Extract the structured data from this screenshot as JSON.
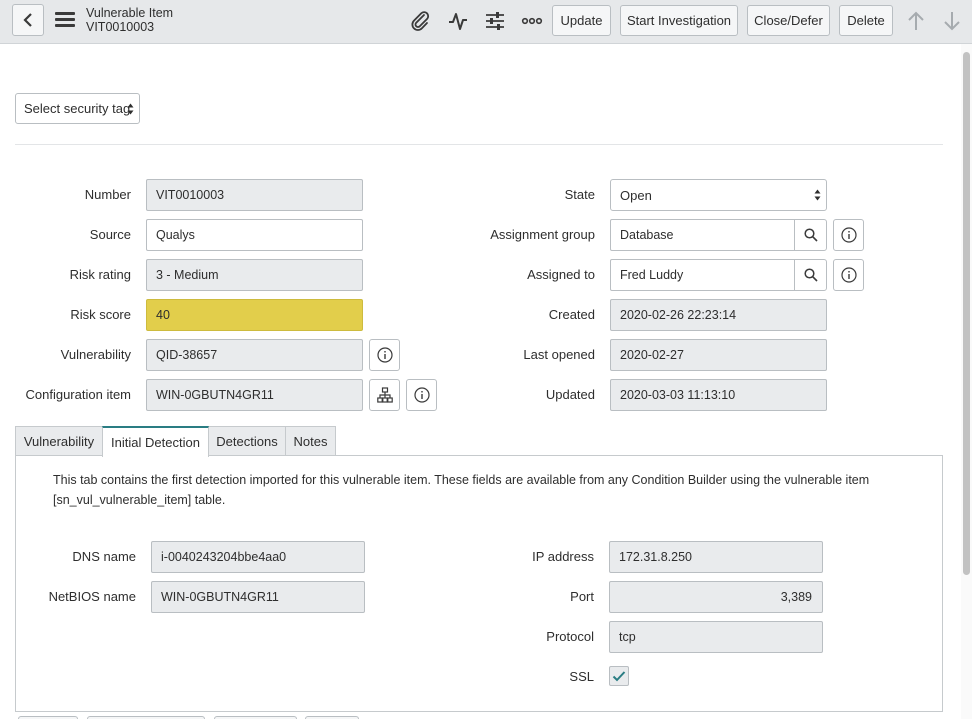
{
  "header": {
    "title": "Vulnerable Item",
    "subtitle": "VIT0010003",
    "buttons": {
      "update": "Update",
      "start_investigation": "Start Investigation",
      "close_defer": "Close/Defer",
      "delete": "Delete"
    }
  },
  "security_tag": {
    "label": "Select security tag"
  },
  "form": {
    "left": {
      "number": {
        "label": "Number",
        "value": "VIT0010003"
      },
      "source": {
        "label": "Source",
        "value": "Qualys"
      },
      "risk_rating": {
        "label": "Risk rating",
        "value": "3 - Medium"
      },
      "risk_score": {
        "label": "Risk score",
        "value": "40"
      },
      "vulnerability": {
        "label": "Vulnerability",
        "value": "QID-38657"
      },
      "configuration_item": {
        "label": "Configuration item",
        "value": "WIN-0GBUTN4GR11"
      }
    },
    "right": {
      "state": {
        "label": "State",
        "value": "Open"
      },
      "assignment_group": {
        "label": "Assignment group",
        "value": "Database"
      },
      "assigned_to": {
        "label": "Assigned to",
        "value": "Fred Luddy"
      },
      "created": {
        "label": "Created",
        "value": "2020-02-26 22:23:14"
      },
      "last_opened": {
        "label": "Last opened",
        "value": "2020-02-27"
      },
      "updated": {
        "label": "Updated",
        "value": "2020-03-03 11:13:10"
      }
    }
  },
  "tabs": [
    {
      "label": "Vulnerability",
      "active": false
    },
    {
      "label": "Initial Detection",
      "active": true
    },
    {
      "label": "Detections",
      "active": false
    },
    {
      "label": "Notes",
      "active": false
    }
  ],
  "detection": {
    "description": "This tab contains the first detection imported for this vulnerable item. These fields are available from any Condition Builder using the vulnerable item [sn_vul_vulnerable_item] table.",
    "dns_name": {
      "label": "DNS name",
      "value": "i-0040243204bbe4aa0"
    },
    "netbios_name": {
      "label": "NetBIOS name",
      "value": "WIN-0GBUTN4GR11"
    },
    "ip_address": {
      "label": "IP address",
      "value": "172.31.8.250"
    },
    "port": {
      "label": "Port",
      "value": "3,389"
    },
    "protocol": {
      "label": "Protocol",
      "value": "tcp"
    },
    "ssl": {
      "label": "SSL",
      "checked": true
    }
  },
  "colors": {
    "risk_score_bg": "#e2ce4b",
    "active_tab_accent": "#2a7d83",
    "header_bg": "#e6e8ea"
  }
}
